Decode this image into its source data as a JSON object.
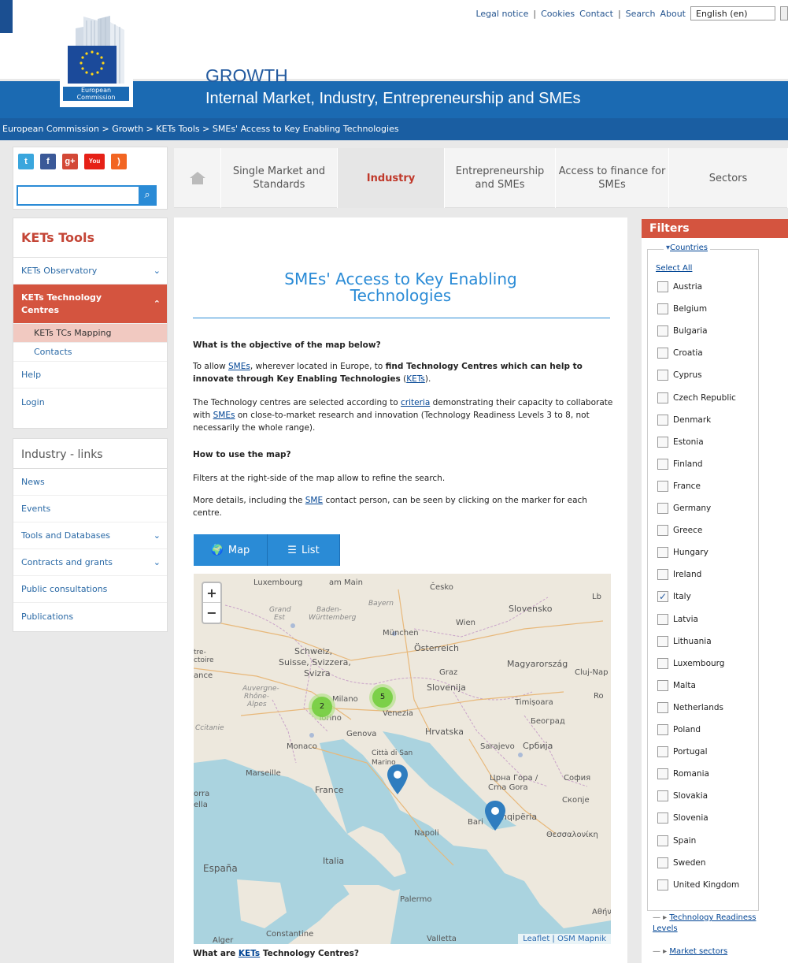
{
  "utility": {
    "links": [
      "Legal notice",
      "Cookies",
      "Contact",
      "Search",
      "About"
    ],
    "language": "English (en)"
  },
  "logo": {
    "org_line1": "European",
    "org_line2": "Commission"
  },
  "header": {
    "title": "GROWTH",
    "subtitle": "Internal Market, Industry, Entrepreneurship and SMEs"
  },
  "breadcrumb": [
    "European Commission",
    "Growth",
    "KETs Tools",
    "SMEs' Access to Key Enabling Technologies"
  ],
  "social": {
    "icons": [
      "twitter-icon",
      "facebook-icon",
      "googleplus-icon",
      "youtube-icon",
      "rss-icon"
    ],
    "search_placeholder": ""
  },
  "nav": {
    "items": [
      "Single Market and Standards",
      "Industry",
      "Entrepreneurship and SMEs",
      "Access to finance for SMEs",
      "Sectors"
    ],
    "active": "Industry"
  },
  "leftnav": {
    "title": "KETs Tools",
    "items": [
      "KETs Observatory",
      "KETs Technology Centres",
      "KETs TCs Mapping",
      "Contacts",
      "Help",
      "Login"
    ]
  },
  "links": {
    "title": "Industry - links",
    "items": [
      "News",
      "Events",
      "Tools and Databases",
      "Contracts and grants",
      "Public consultations",
      "Publications"
    ]
  },
  "main": {
    "title_line1": "SMEs' Access to Key Enabling",
    "title_line2": "Technologies",
    "q1": "What is the objective of the map below?",
    "p1_a": "To allow",
    "p1_link1": "SMEs",
    "p1_b": ", wherever located in Europe, to",
    "p1_bold": "find Technology Centres which can help to innovate through Key Enabling Technologies",
    "p1_c": "(",
    "p1_link2": "KETs",
    "p1_d": ").",
    "p2_a": "The Technology centres are selected according to",
    "p2_link1": "criteria",
    "p2_b": "demonstrating their capacity to collaborate with",
    "p2_link2": "SMEs",
    "p2_c": "on close-to-market research and innovation (Technology Readiness Levels 3 to 8, not necessarily the whole range).",
    "q2": "How to use the map?",
    "p3": "Filters at the right-side of the map allow to refine the search.",
    "p4_a": "More details, including the",
    "p4_link": "SME",
    "p4_b": "contact person, can be seen by clicking on the marker for each centre.",
    "tab_map": "Map",
    "tab_list": "List",
    "q3_a": "What are",
    "q3_link": "KETs",
    "q3_b": "Technology Centres?"
  },
  "map": {
    "zoom_in": "+",
    "zoom_out": "−",
    "attribution": "Leaflet | OSM Mapnik",
    "clusters": [
      "2",
      "5"
    ],
    "labels": [
      "Luxembourg",
      "am Main",
      "Česko",
      "Grand Est",
      "Baden-Württemberg",
      "Bayern",
      "Slovensko",
      "Wien",
      "München",
      "Österreich",
      "Magyarország",
      "Schweiz, Suisse, Svizzera, Svizra",
      "Graz",
      "Slovenija",
      "Cluj-Nap",
      "Milano",
      "Venezia",
      "Timișoara",
      "Ro",
      "Torino",
      "Genova",
      "Hrvatska",
      "Београд",
      "Monaco",
      "Sarajevo",
      "Србија",
      "Città di San Marino",
      "Marseille",
      "Црна Гора / Crna Gora",
      "София",
      "France",
      "Italia",
      "Скопје",
      "Shqipëria",
      "Bari",
      "Napoli",
      "Θεσσαλονίκη",
      "España",
      "Palermo",
      "Alger",
      "Constantine",
      "Valletta",
      "Αθήνα",
      "Lb",
      "Auvergne-Rhône-Alpes",
      "Ccitanie",
      "orra",
      "ella",
      "ance",
      "tre-ctoire"
    ]
  },
  "filters": {
    "title": "Filters",
    "countries_legend": "Countries",
    "select_all": "Select All",
    "countries": [
      "Austria",
      "Belgium",
      "Bulgaria",
      "Croatia",
      "Cyprus",
      "Czech Republic",
      "Denmark",
      "Estonia",
      "Finland",
      "France",
      "Germany",
      "Greece",
      "Hungary",
      "Ireland",
      "Italy",
      "Latvia",
      "Lithuania",
      "Luxembourg",
      "Malta",
      "Netherlands",
      "Poland",
      "Portugal",
      "Romania",
      "Slovakia",
      "Slovenia",
      "Spain",
      "Sweden",
      "United Kingdom"
    ],
    "checked": "Italy",
    "trl": "Technology Readiness Levels",
    "market": "Market sectors"
  }
}
